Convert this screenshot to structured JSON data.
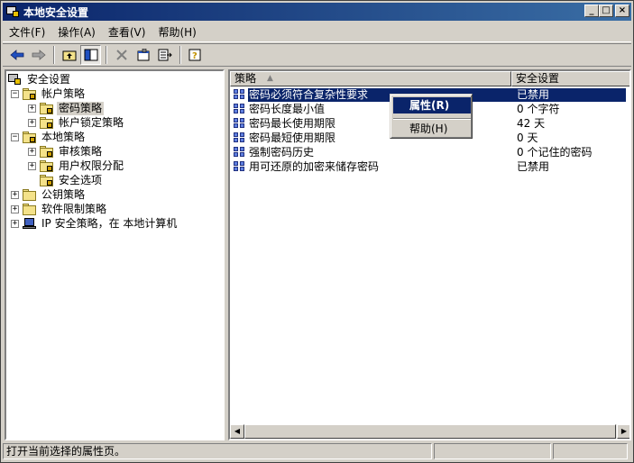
{
  "window": {
    "title": "本地安全设置",
    "min_glyph": "_",
    "max_glyph": "□",
    "close_glyph": "×"
  },
  "menubar": {
    "items": [
      "文件(F)",
      "操作(A)",
      "查看(V)",
      "帮助(H)"
    ]
  },
  "toolbar": {
    "buttons": [
      "back-arrow-icon",
      "forward-arrow-icon",
      "up-folder-icon",
      "show-hide-tree-icon",
      "delete-icon",
      "properties-icon",
      "export-list-icon",
      "help-icon"
    ]
  },
  "tree": {
    "root": "安全设置",
    "account_policy": "帐户策略",
    "password_policy": "密码策略",
    "lockout_policy": "帐户锁定策略",
    "local_policy": "本地策略",
    "audit_policy": "审核策略",
    "user_rights": "用户权限分配",
    "security_options": "安全选项",
    "public_key": "公钥策略",
    "software_restriction": "软件限制策略",
    "ip_security": "IP 安全策略，在 本地计算机"
  },
  "list": {
    "col_policy": "策略",
    "col_setting": "安全设置",
    "rows": [
      {
        "name": "密码必须符合复杂性要求",
        "value": "已禁用"
      },
      {
        "name": "密码长度最小值",
        "value": "0 个字符"
      },
      {
        "name": "密码最长使用期限",
        "value": "42 天"
      },
      {
        "name": "密码最短使用期限",
        "value": "0 天"
      },
      {
        "name": "强制密码历史",
        "value": "0 个记住的密码"
      },
      {
        "name": "用可还原的加密来储存密码",
        "value": "已禁用"
      }
    ]
  },
  "context_menu": {
    "properties": "属性(R)",
    "help": "帮助(H)"
  },
  "statusbar": {
    "text": "打开当前选择的属性页。"
  },
  "colors": {
    "selection": "#0a246a",
    "titlebar_start": "#0a246a",
    "titlebar_end": "#3a6ea5",
    "face": "#d4d0c8"
  }
}
